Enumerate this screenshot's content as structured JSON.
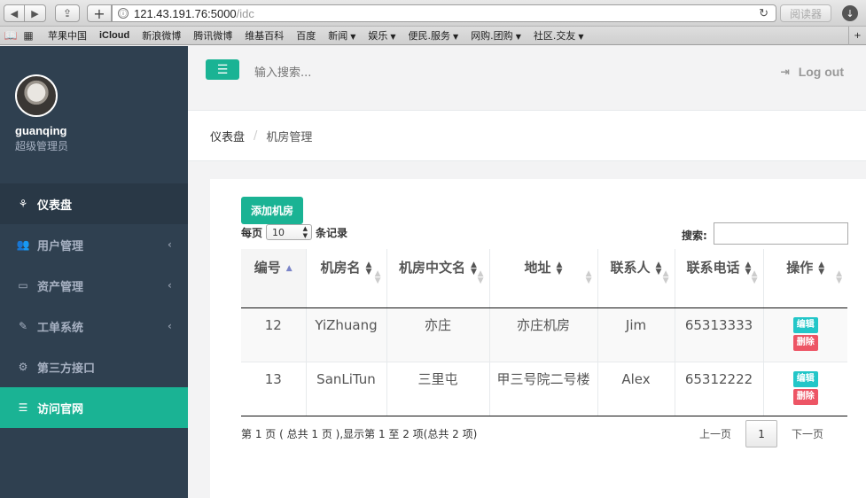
{
  "browser": {
    "url_host": "121.43.191.76:5000",
    "url_path": "/idc",
    "reader_label": "阅读器",
    "bookmarks": [
      {
        "label": "苹果中国",
        "dropdown": false,
        "bold": false
      },
      {
        "label": "iCloud",
        "dropdown": false,
        "bold": true
      },
      {
        "label": "新浪微博",
        "dropdown": false,
        "bold": false
      },
      {
        "label": "腾讯微博",
        "dropdown": false,
        "bold": false
      },
      {
        "label": "维基百科",
        "dropdown": false,
        "bold": false
      },
      {
        "label": "百度",
        "dropdown": false,
        "bold": false
      },
      {
        "label": "新闻",
        "dropdown": true,
        "bold": false
      },
      {
        "label": "娱乐",
        "dropdown": true,
        "bold": false
      },
      {
        "label": "便民.服务",
        "dropdown": true,
        "bold": false
      },
      {
        "label": "网购.团购",
        "dropdown": true,
        "bold": false
      },
      {
        "label": "社区.交友",
        "dropdown": true,
        "bold": false
      }
    ]
  },
  "sidebar": {
    "username": "guanqing",
    "role": "超级管理员",
    "items": [
      {
        "label": "仪表盘",
        "icon": "dashboard-icon",
        "glyph": "⚘",
        "chevron": false,
        "state": "dash"
      },
      {
        "label": "用户管理",
        "icon": "users-icon",
        "glyph": "👥",
        "chevron": true,
        "state": ""
      },
      {
        "label": "资产管理",
        "icon": "inbox-icon",
        "glyph": "▭",
        "chevron": true,
        "state": ""
      },
      {
        "label": "工单系统",
        "icon": "edit-icon",
        "glyph": "✎",
        "chevron": true,
        "state": ""
      },
      {
        "label": "第三方接口",
        "icon": "gears-icon",
        "glyph": "⚙",
        "chevron": false,
        "state": ""
      },
      {
        "label": "访问官网",
        "icon": "database-icon",
        "glyph": "☰",
        "chevron": false,
        "state": "active"
      }
    ]
  },
  "topbar": {
    "search_placeholder": "输入搜索...",
    "logout_label": "Log out"
  },
  "breadcrumb": {
    "home": "仪表盘",
    "separator": "/",
    "current": "机房管理"
  },
  "table_controls": {
    "add_label": "添加机房",
    "per_page_prefix": "每页",
    "per_page_value": "10",
    "per_page_suffix": "条记录",
    "search_label": "搜索:"
  },
  "table": {
    "columns": [
      "编号",
      "机房名",
      "机房中文名",
      "地址",
      "联系人",
      "联系电话",
      "操作"
    ],
    "rows": [
      {
        "id": "12",
        "name": "YiZhuang",
        "cn_name": "亦庄",
        "address": "亦庄机房",
        "contact": "Jim",
        "phone": "65313333"
      },
      {
        "id": "13",
        "name": "SanLiTun",
        "cn_name": "三里屯",
        "address": "甲三号院二号楼",
        "contact": "Alex",
        "phone": "65312222"
      }
    ],
    "edit_label": "编辑",
    "delete_label": "删除"
  },
  "pagination": {
    "info": "第 1 页 ( 总共 1 页 ),显示第 1 至 2 项(总共 2 项)",
    "prev_label": "上一页",
    "current_page": "1",
    "next_label": "下一页"
  },
  "colors": {
    "sidebar_bg": "#2f4050",
    "accent": "#1ab394",
    "edit": "#23c6c8",
    "delete": "#ed5565"
  }
}
